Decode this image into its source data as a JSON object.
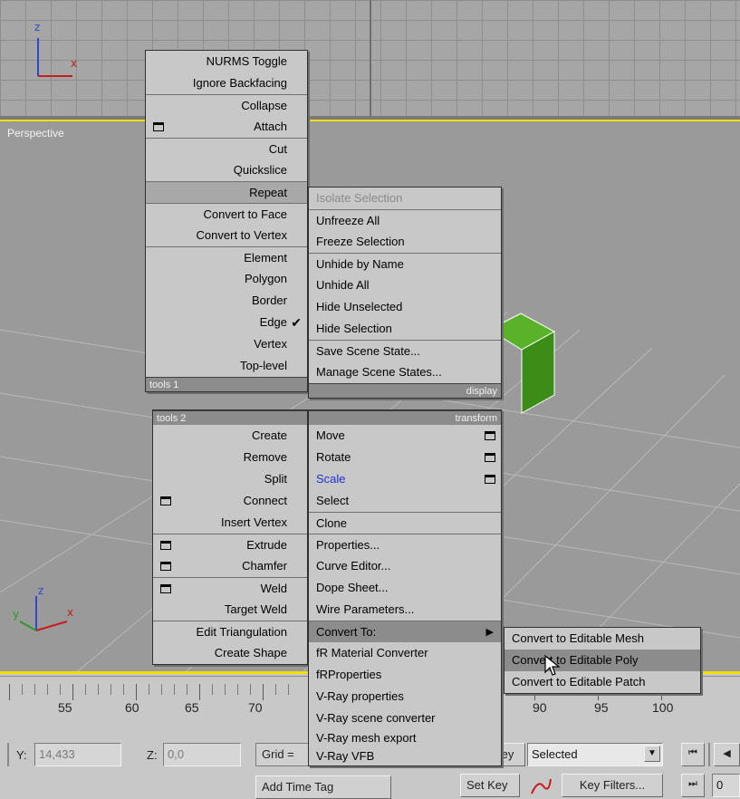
{
  "viewports": {
    "perspective_label": "Perspective",
    "top_axis": {
      "z": "z",
      "x": "x"
    },
    "persp_axis": {
      "z": "z",
      "x": "x",
      "y": "y"
    }
  },
  "colors": {
    "accent": "#f0e000",
    "object_green": "#3c8c18",
    "selection": "#2030d0"
  },
  "quad_left_top": {
    "items": [
      "NURMS Toggle",
      "Ignore Backfacing",
      "Collapse",
      "Attach",
      "Cut",
      "Quickslice",
      "Repeat",
      "Convert to Face",
      "Convert to Vertex",
      "Element",
      "Polygon",
      "Border",
      "Edge",
      "Vertex",
      "Top-level"
    ],
    "checked": "Edge",
    "header": "tools 1"
  },
  "quad_right_top": {
    "items": [
      "Isolate Selection",
      "Unfreeze All",
      "Freeze Selection",
      "Unhide by Name",
      "Unhide All",
      "Hide Unselected",
      "Hide Selection",
      "Save Scene State...",
      "Manage Scene States..."
    ],
    "header": "display"
  },
  "quad_left_bottom": {
    "header": "tools 2",
    "items": [
      "Create",
      "Remove",
      "Split",
      "Connect",
      "Insert Vertex",
      "Extrude",
      "Chamfer",
      "Weld",
      "Target Weld",
      "Edit Triangulation",
      "Create Shape"
    ]
  },
  "quad_right_bottom": {
    "header": "transform",
    "items": [
      "Move",
      "Rotate",
      "Scale",
      "Select",
      "Clone",
      "Properties...",
      "Curve Editor...",
      "Dope Sheet...",
      "Wire Parameters...",
      "Convert To:",
      "fR Material Converter",
      "fRProperties",
      "V-Ray properties",
      "V-Ray scene converter",
      "V-Ray mesh export",
      "V-Ray VFB"
    ]
  },
  "convert_submenu": {
    "items": [
      "Convert to Editable Mesh",
      "Convert to Editable Poly",
      "Convert to Editable Patch"
    ],
    "highlighted": "Convert to Editable Poly"
  },
  "timeline": {
    "labels": [
      "55",
      "60",
      "65",
      "70",
      "90",
      "95",
      "100"
    ]
  },
  "status": {
    "y_label": "Y:",
    "y_value": "14,433",
    "z_label": "Z:",
    "z_value": "0,0",
    "grid_label": "Grid =",
    "add_time_tag": "Add Time Tag",
    "key_label": "Key",
    "set_key": "Set Key",
    "selected_value": "Selected",
    "key_filters": "Key Filters...",
    "frame_value": "0"
  }
}
